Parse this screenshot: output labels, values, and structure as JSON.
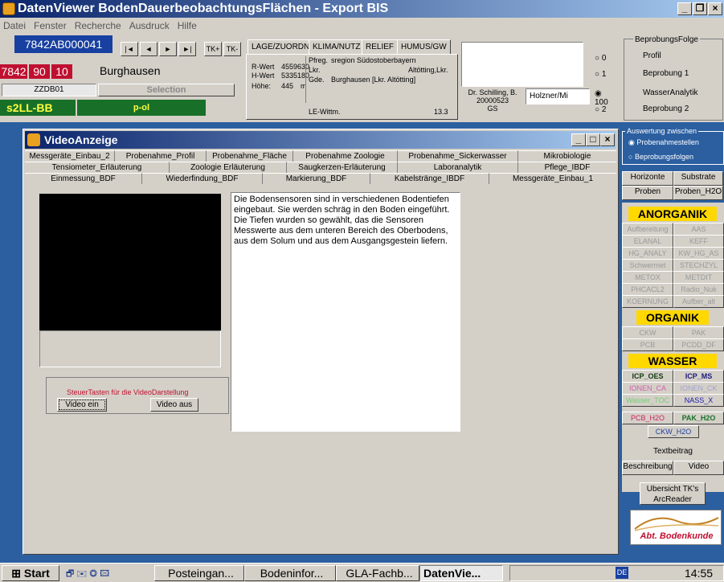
{
  "app": {
    "title": "DatenViewer BodenDauerbeobachtungsFlächen - Export BIS",
    "min": "_",
    "max": "❒",
    "close": "×"
  },
  "menu": [
    "Datei",
    "Fenster",
    "Recherche",
    "Ausdruck",
    "Hilfe"
  ],
  "record": {
    "id": "7842AB000041",
    "code1": "7842",
    "code2": "90",
    "code3": "10",
    "place": "Burghausen",
    "sub": "ZZDB01",
    "selection": "Selection",
    "type": "s2LL-BB",
    "subtype": "p-ol"
  },
  "nav": {
    "first": "|◄",
    "prev": "◄",
    "next": "►",
    "last": "►|",
    "tkplus": "TK+",
    "tkminus": "TK-"
  },
  "toptabs": [
    "LAGE/ZUORDN",
    "KLIMA/NUTZ",
    "RELIEF",
    "HUMUS/GW"
  ],
  "location": {
    "rwert_l": "R-Wert",
    "rwert": "4559630",
    "hwert_l": "H-Wert",
    "hwert": "5335180",
    "hoehe_l": "Höhe:",
    "hoehe": "445",
    "hoehe_u": "m",
    "preg_l": "Pfreg.",
    "preg": "sregion Südostoberbayern",
    "lkr_l": "Lkr.",
    "lkr": "Altötting,Lkr.",
    "gde_l": "Gde.",
    "gde": "Burghausen [Lkr. Altötting]",
    "le_l": "LE-Wittm.",
    "le": "13.3"
  },
  "person": {
    "name": "Dr. Schilling, B.",
    "date": "20000523",
    "org": "GS",
    "other": "Holzner/Mi"
  },
  "sampling": {
    "title": "BeprobungsFolge",
    "options": [
      "0",
      "1",
      "100",
      "2"
    ],
    "selected": "100",
    "labels": [
      "Profil",
      "Beprobung 1",
      "WasserAnalytik",
      "Beprobung 2"
    ]
  },
  "auswertung": {
    "title": "Auswertung zwischen",
    "opt1": "Probenahmestellen",
    "opt2": "Beprobungsfolgen"
  },
  "video": {
    "title": "VideoAnzeige",
    "tabs1": [
      "Messgeräte_Einbau_2",
      "Probenahme_Profil",
      "Probenahme_Fläche",
      "Probenahme Zoologie",
      "Probenahme_Sickerwasser",
      "Mikrobiologie"
    ],
    "tabs2": [
      "Tensiometer_Erläuterung",
      "Zoologie Erläuterung",
      "Saugkerzen-Erläuterung",
      "Laboranalytik",
      "Pflege_IBDF"
    ],
    "tabs3": [
      "Einmessung_BDF",
      "Wiederfindung_BDF",
      "Markierung_BDF",
      "Kabelstränge_IBDF",
      "Messgeräte_Einbau_1"
    ],
    "text": "Die Bodensensoren sind in verschiedenen Bodentiefen eingebaut. Sie werden schräg in den Boden eingeführt. Die Tiefen wurden so gewählt, das die Sensoren Messwerte aus dem unteren Bereich des Oberbodens, aus dem Solum und aus dem Ausgangsgestein liefern.",
    "ctrl_label": "SteuerTasten für die VideoDarstellung",
    "on": "Video ein",
    "off": "Video aus"
  },
  "right": {
    "horizonte": "Horizonte",
    "substrate": "Substrate",
    "proben": "Proben",
    "proben_h2o": "Proben_H2O",
    "anorganik": "ANORGANIK",
    "anorg": [
      "Aufbereitung",
      "AAS",
      "ELANAL",
      "KEFF",
      "HG_ANALY",
      "KW_HG_AS",
      "Schwermet",
      "STECHZYL",
      "METOX",
      "METDIT",
      "PHCACL2",
      "Radio_Nuk",
      "KOERNUNG",
      "Aufber_alt"
    ],
    "organik": "ORGANIK",
    "org": [
      "CKW",
      "PAK",
      "PCB",
      "PCDD_DF"
    ],
    "wasser": "WASSER",
    "wass": [
      "ICP_OES",
      "ICP_MS",
      "IONEN_CA",
      "IONEN_CK",
      "Wasser_TOC",
      "NASS_X",
      "PCB_H2O",
      "PAK_H2O",
      "CKW_H2O"
    ],
    "textbeitrag": "Textbeitrag",
    "beschreibung": "Beschreibung",
    "video": "Video",
    "uebersicht": "Ubersicht TK's",
    "arcreader": "ArcReader",
    "logo": "Abt. Bodenkunde"
  },
  "taskbar": {
    "start": "Start",
    "tasks": [
      "Posteingan...",
      "Bodeninfor...",
      "GLA-Fachb...",
      "DatenVie..."
    ],
    "lang": "DE",
    "time": "14:55"
  }
}
